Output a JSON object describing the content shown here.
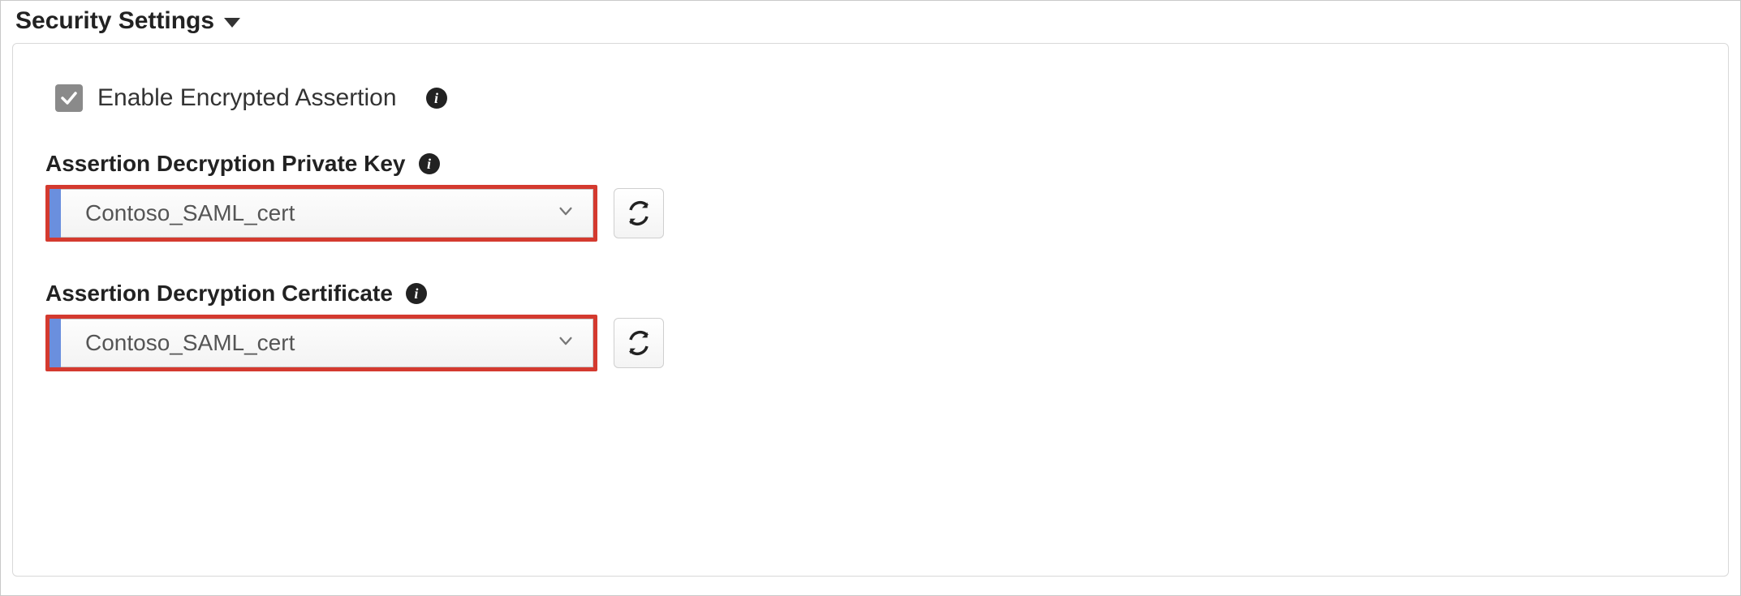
{
  "section": {
    "title": "Security Settings"
  },
  "checkbox": {
    "label": "Enable Encrypted Assertion",
    "checked": true
  },
  "fields": {
    "privateKey": {
      "label": "Assertion Decryption Private Key",
      "value": "Contoso_SAML_cert"
    },
    "certificate": {
      "label": "Assertion Decryption Certificate",
      "value": "Contoso_SAML_cert"
    }
  },
  "highlight_color": "#d43a2f",
  "accent_color": "#6a8fde"
}
